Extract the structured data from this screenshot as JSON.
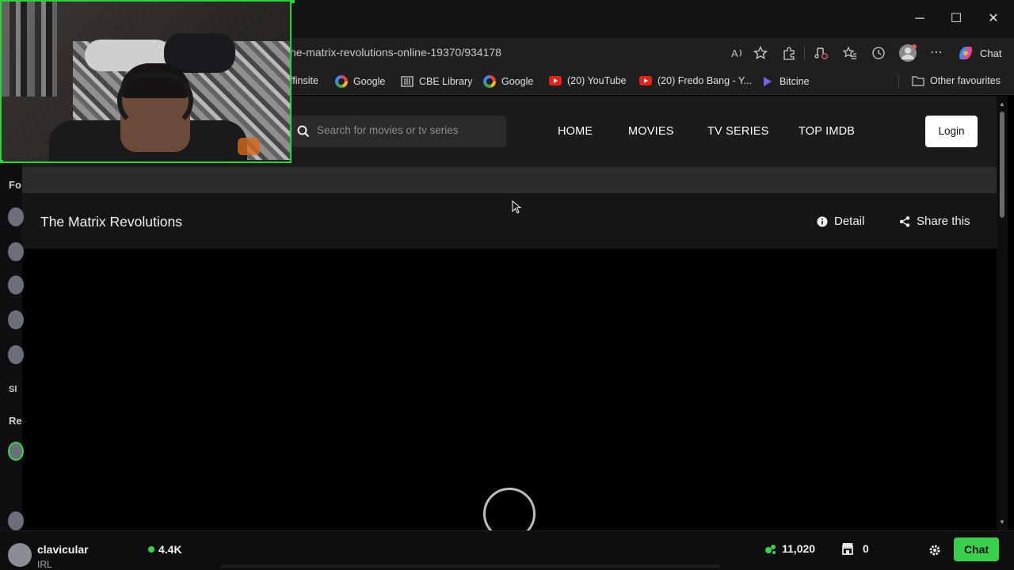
{
  "browser": {
    "url": "he-matrix-revolutions-online-19370/934178",
    "window_controls": {
      "minimize": "─",
      "maximize": "☐",
      "close": "✕"
    },
    "copilot_label": "Chat",
    "favourites": [
      {
        "label": "ffinsite",
        "icon": "none"
      },
      {
        "label": "Google",
        "icon": "google-icon"
      },
      {
        "label": "CBE Library",
        "icon": "library-icon"
      },
      {
        "label": "Google",
        "icon": "google-icon"
      },
      {
        "label": "(20) YouTube",
        "icon": "youtube-icon"
      },
      {
        "label": "(20) Fredo Bang - Y...",
        "icon": "youtube-icon"
      },
      {
        "label": "Bitcine",
        "icon": "bitcine-icon"
      }
    ],
    "other_favourites": "Other favourites"
  },
  "site": {
    "search_placeholder": "Search for movies or tv series",
    "nav": {
      "home": "HOME",
      "movies": "MOVIES",
      "tv_series": "TV SERIES",
      "top_imdb": "TOP IMDB"
    },
    "login": "Login",
    "movie_title": "The Matrix Revolutions",
    "detail": "Detail",
    "share": "Share this"
  },
  "sidebar": {
    "fragments": [
      "Fo",
      "Sl",
      "Re"
    ]
  },
  "stream": {
    "streamer": "clavicular",
    "category": "IRL",
    "viewers": "4.4K",
    "points": "11,020",
    "store_count": "0",
    "chat_label": "Chat"
  },
  "colors": {
    "accent_green": "#37d14a",
    "webcam_border": "#2ad437",
    "site_header_bg": "#1b1b1b"
  }
}
